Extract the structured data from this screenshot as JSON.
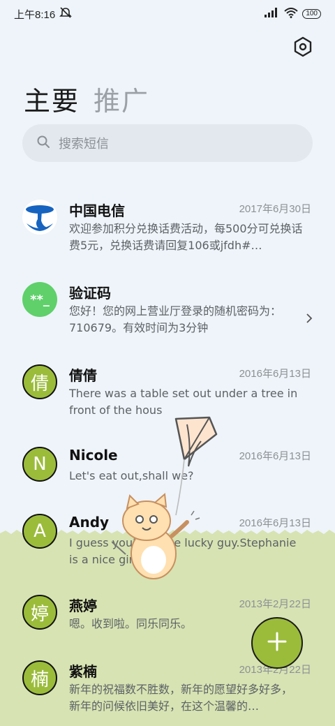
{
  "status": {
    "time": "上午8:16",
    "battery": "100"
  },
  "tabs": [
    {
      "label": "主要",
      "active": true
    },
    {
      "label": "推广",
      "active": false
    }
  ],
  "search": {
    "placeholder": "搜索短信"
  },
  "messages": [
    {
      "name": "中国电信",
      "date": "2017年6月30日",
      "preview": "欢迎参加积分兑换话费活动，每500分可兑换话费5元，兑换话费请回复106或jfdh#…",
      "avatar": "telecom-logo"
    },
    {
      "name": "验证码",
      "date": "",
      "preview": "您好！您的网上营业厅登录的随机密码为：710679。有效时间为3分钟",
      "avatar": "**_"
    },
    {
      "name": "倩倩",
      "date": "2016年6月13日",
      "preview": "There was a table set out under a tree in front of the hous",
      "avatar": "倩"
    },
    {
      "name": "Nicole",
      "date": "2016年6月13日",
      "preview": "Let's eat out,shall we?",
      "avatar": "N"
    },
    {
      "name": "Andy",
      "date": "2016年6月13日",
      "preview": "I guess you're some lucky guy.Stephanie is a nice girl.",
      "avatar": "A"
    },
    {
      "name": "燕婷",
      "date": "2013年2月22日",
      "preview": "嗯。收到啦。同乐同乐。",
      "avatar": "婷"
    },
    {
      "name": "紫楠",
      "date": "2013年2月22日",
      "preview": "新年的祝福数不胜数，新年的愿望好多好多，新年的问候依旧美好，在这个温馨的…",
      "avatar": "楠"
    }
  ],
  "colors": {
    "accent": "#9bbc3b",
    "grass": "#d7e3b2",
    "background": "#eef4f9"
  }
}
